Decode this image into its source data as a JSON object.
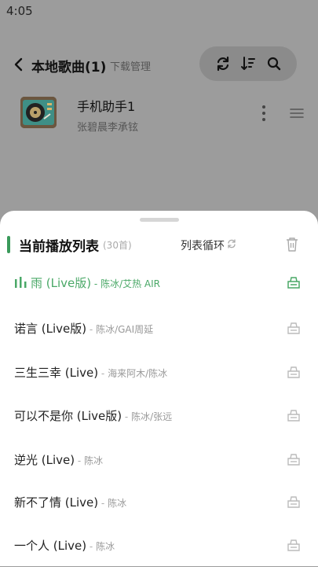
{
  "status": {
    "time": "4:05"
  },
  "header": {
    "title": "本地歌曲(1)",
    "subtitle": "下载管理"
  },
  "current_song": {
    "title": "手机助手1",
    "artist": "张碧晨李承铉"
  },
  "playlist": {
    "title": "当前播放列表",
    "count": "(30首)",
    "mode_label": "列表循环",
    "tracks": [
      {
        "title": "雨 (Live版)",
        "artist": "陈冰/艾热 AIR",
        "playing": true
      },
      {
        "title": "诺言 (Live版)",
        "artist": "陈冰/GAI周延",
        "playing": false
      },
      {
        "title": "三生三幸 (Live)",
        "artist": "海来阿木/陈冰",
        "playing": false
      },
      {
        "title": "可以不是你 (Live版)",
        "artist": "陈冰/张远",
        "playing": false
      },
      {
        "title": "逆光 (Live)",
        "artist": "陈冰",
        "playing": false
      },
      {
        "title": "新不了情 (Live)",
        "artist": "陈冰",
        "playing": false
      },
      {
        "title": "一个人 (Live)",
        "artist": "陈冰",
        "playing": false
      }
    ]
  },
  "colors": {
    "accent": "#4aa867",
    "overlay": "#9c9c9c"
  },
  "icons": [
    "back-arrow-icon",
    "repeat-icon",
    "sort-icon",
    "search-icon",
    "more-vertical-icon",
    "drag-handle-icon",
    "loop-icon",
    "trash-icon",
    "equalizer-icon",
    "download-icon"
  ]
}
